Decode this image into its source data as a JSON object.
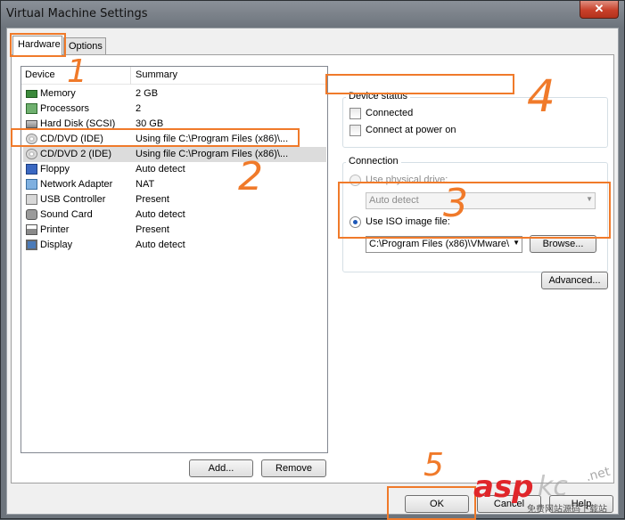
{
  "window": {
    "title": "Virtual Machine Settings",
    "close_glyph": "✕"
  },
  "tabs": [
    {
      "label": "Hardware"
    },
    {
      "label": "Options"
    }
  ],
  "device_list": {
    "columns": [
      "Device",
      "Summary"
    ],
    "rows": [
      {
        "device": "Memory",
        "summary": "2 GB",
        "icon": "memory-icon"
      },
      {
        "device": "Processors",
        "summary": "2",
        "icon": "processor-icon"
      },
      {
        "device": "Hard Disk (SCSI)",
        "summary": "30 GB",
        "icon": "harddisk-icon"
      },
      {
        "device": "CD/DVD (IDE)",
        "summary": "Using file C:\\Program Files (x86)\\...",
        "icon": "cd-icon"
      },
      {
        "device": "CD/DVD 2 (IDE)",
        "summary": "Using file C:\\Program Files (x86)\\...",
        "icon": "cd-icon"
      },
      {
        "device": "Floppy",
        "summary": "Auto detect",
        "icon": "floppy-icon"
      },
      {
        "device": "Network Adapter",
        "summary": "NAT",
        "icon": "network-icon"
      },
      {
        "device": "USB Controller",
        "summary": "Present",
        "icon": "usb-icon"
      },
      {
        "device": "Sound Card",
        "summary": "Auto detect",
        "icon": "sound-icon"
      },
      {
        "device": "Printer",
        "summary": "Present",
        "icon": "printer-icon"
      },
      {
        "device": "Display",
        "summary": "Auto detect",
        "icon": "display-icon"
      }
    ]
  },
  "buttons": {
    "add": "Add...",
    "remove": "Remove",
    "browse": "Browse...",
    "advanced": "Advanced...",
    "ok": "OK",
    "cancel": "Cancel",
    "help": "Help"
  },
  "device_status": {
    "label": "Device status",
    "connected": "Connected",
    "connect_at_power_on": "Connect at power on"
  },
  "connection": {
    "label": "Connection",
    "use_physical_drive": "Use physical drive:",
    "physical_drive_value": "Auto detect",
    "use_iso": "Use ISO image file:",
    "iso_path": "C:\\Program Files (x86)\\VMware\\"
  },
  "annotations": [
    "1",
    "2",
    "3",
    "4",
    "5"
  ],
  "watermark": {
    "brand": "asp",
    "brand2": "kc",
    "site": ".net",
    "tagline": "免费网站源码下载站"
  },
  "colors": {
    "highlight": "#f07a2a",
    "brand_red": "#e0262a"
  }
}
